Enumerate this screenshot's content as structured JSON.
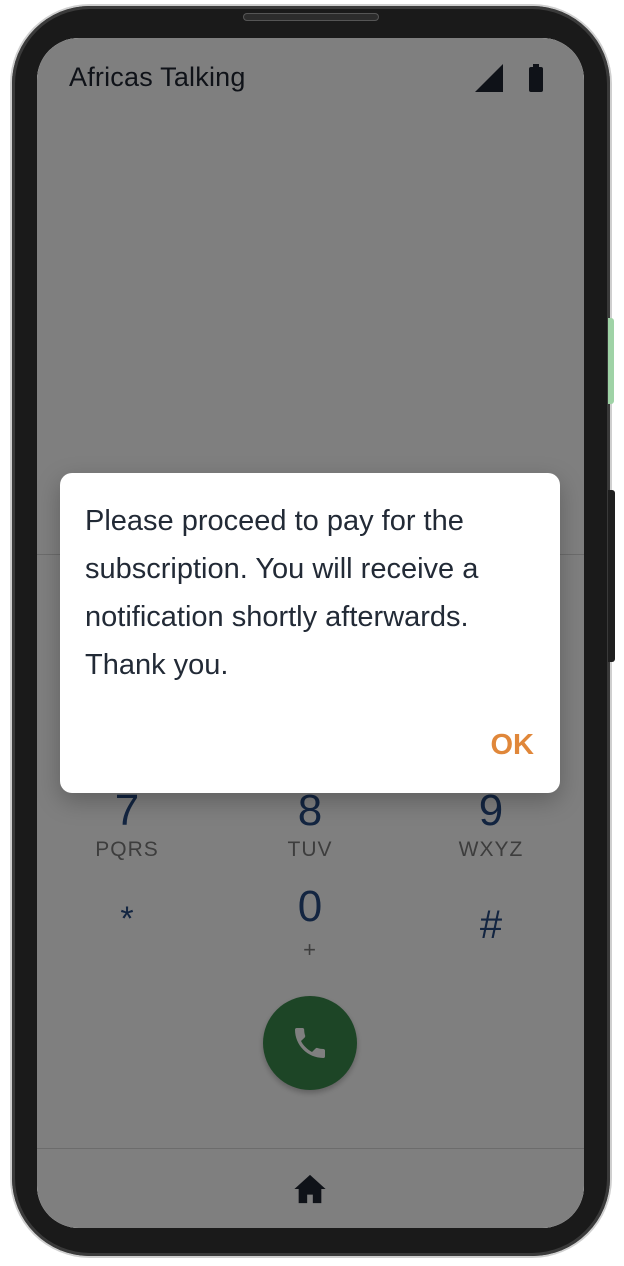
{
  "app": {
    "title": "Africas Talking"
  },
  "status_icons": {
    "signal": "cellular-signal-icon",
    "battery": "battery-icon"
  },
  "keypad": {
    "keys": [
      {
        "digit": "7",
        "letters": "PQRS"
      },
      {
        "digit": "8",
        "letters": "TUV"
      },
      {
        "digit": "9",
        "letters": "WXYZ"
      },
      {
        "digit": "*",
        "letters": ""
      },
      {
        "digit": "0",
        "letters": "+"
      },
      {
        "digit": "#",
        "letters": ""
      }
    ]
  },
  "call_button": {
    "icon": "phone-icon",
    "color": "#3b8a4d"
  },
  "bottom_nav": {
    "home_icon": "home-icon"
  },
  "dialog": {
    "message": "Please proceed to pay for the subscription. You will receive a notification shortly afterwards. Thank you.",
    "ok_label": "OK",
    "ok_color": "#e0873a"
  },
  "colors": {
    "digit": "#264b82",
    "accent": "#e0873a",
    "call": "#3b8a4d"
  }
}
